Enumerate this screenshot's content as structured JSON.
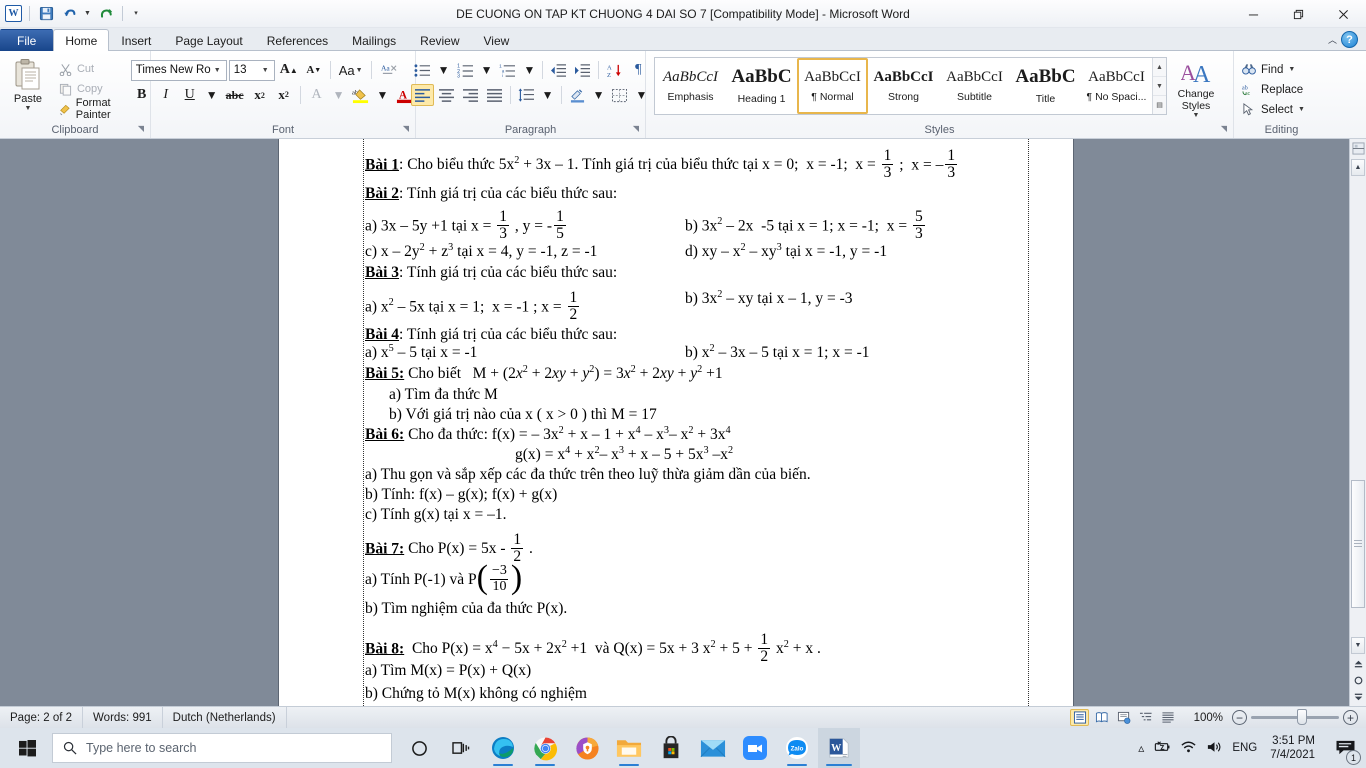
{
  "titlebar": {
    "document_title": "DE CUONG ON TAP KT CHUONG 4 DAI SO 7 [Compatibility Mode]  -  Microsoft Word",
    "qat": [
      "word-logo",
      "save",
      "undo",
      "redo",
      "customize-qat"
    ],
    "minimize": "—",
    "restore": "❐",
    "close": "✕"
  },
  "tabs": {
    "items": [
      {
        "label": "File",
        "kind": "file"
      },
      {
        "label": "Home",
        "kind": "active"
      },
      {
        "label": "Insert",
        "kind": "normal"
      },
      {
        "label": "Page Layout",
        "kind": "normal"
      },
      {
        "label": "References",
        "kind": "normal"
      },
      {
        "label": "Mailings",
        "kind": "normal"
      },
      {
        "label": "Review",
        "kind": "normal"
      },
      {
        "label": "View",
        "kind": "normal"
      }
    ],
    "help": "?"
  },
  "ribbon": {
    "clipboard": {
      "label": "Clipboard",
      "paste": "Paste",
      "cut": "Cut",
      "copy": "Copy",
      "format_painter": "Format Painter"
    },
    "font": {
      "label": "Font",
      "font_family": "Times New Rom",
      "font_size": "13",
      "grow": "A",
      "shrink": "A",
      "change_case": "Aa",
      "clear_formatting": "clear-formatting-icon",
      "bold": "B",
      "italic": "I",
      "underline": "U",
      "strikethrough": "abc",
      "subscript": "x",
      "superscript": "x",
      "text_effects": "A",
      "highlight": "ab",
      "font_color": "A"
    },
    "paragraph": {
      "label": "Paragraph",
      "bullets": "bullets-icon",
      "numbering": "numbering-icon",
      "multilevel": "multilevel-list-icon",
      "decrease_indent": "decrease-indent-icon",
      "increase_indent": "increase-indent-icon",
      "sort": "sort-icon",
      "show_marks": "¶",
      "align_left": "align-left-icon",
      "align_center": "align-center-icon",
      "align_right": "align-right-icon",
      "justify": "justify-icon",
      "line_spacing": "line-spacing-icon",
      "shading": "shading-icon",
      "borders": "borders-icon"
    },
    "styles": {
      "label": "Styles",
      "items": [
        {
          "preview": "AaBbCcI",
          "name": "Emphasis",
          "style": "emphasis"
        },
        {
          "preview": "AaBbC",
          "name": "Heading 1",
          "style": "heading1"
        },
        {
          "preview": "AaBbCcI",
          "name": "¶ Normal",
          "style": "normal",
          "selected": true
        },
        {
          "preview": "AaBbCcI",
          "name": "Strong",
          "style": "strong"
        },
        {
          "preview": "AaBbCcI",
          "name": "Subtitle",
          "style": "subtitle"
        },
        {
          "preview": "AaBbC",
          "name": "Title",
          "style": "title"
        },
        {
          "preview": "AaBbCcI",
          "name": "¶ No Spaci...",
          "style": "nospacing"
        }
      ],
      "change_styles": "Change Styles"
    },
    "editing": {
      "label": "Editing",
      "find": "Find",
      "replace": "Replace",
      "select": "Select"
    }
  },
  "document": {
    "lines": [
      {
        "id": "bai1",
        "label": "Bài 1",
        "text": ": Cho biểu thức 5x² + 3x – 1. Tính giá trị của biểu thức tại x = 0;  x = -1;  x = 1/3 ;  x = – 1/3"
      },
      {
        "id": "bai2",
        "label": "Bài 2",
        "text": ": Tính giá trị của các biểu thức sau:"
      },
      {
        "id": "bai2a",
        "text": "a) 3x – 5y +1 tại x = 1/3 , y = - 1/5"
      },
      {
        "id": "bai2b",
        "text": "b) 3x² – 2x  -5 tại x = 1; x = -1;  x = 5/3"
      },
      {
        "id": "bai2c",
        "text": "c) x – 2y² + z³ tại x = 4, y = -1, z = -1"
      },
      {
        "id": "bai2d",
        "text": "d) xy – x² – xy³ tại x = -1, y = -1"
      },
      {
        "id": "bai3",
        "label": "Bài 3",
        "text": ": Tính giá trị của các biểu thức sau:"
      },
      {
        "id": "bai3a",
        "text": "a) x² – 5x tại x = 1;  x = -1 ; x = 1/2"
      },
      {
        "id": "bai3b",
        "text": "b) 3x² – xy tại x – 1, y = -3"
      },
      {
        "id": "bai4",
        "label": "Bài 4",
        "text": ": Tính giá trị của các biểu thức sau:"
      },
      {
        "id": "bai4a",
        "text": "a) x⁵ – 5 tại x = -1"
      },
      {
        "id": "bai4b",
        "text": "b) x² – 3x – 5 tại x = 1; x = -1"
      },
      {
        "id": "bai5",
        "label": "Bài 5:",
        "text": " Cho biết   M + (2x² + 2xy + y²) = 3x² + 2xy + y² +1"
      },
      {
        "id": "bai5a",
        "text": "a)  Tìm đa thức M"
      },
      {
        "id": "bai5b",
        "text": "b)  Với giá trị nào của x ( x > 0 ) thì M = 17"
      },
      {
        "id": "bai6",
        "label": "Bài 6:",
        "text": " Cho đa thức: f(x) = – 3x² + x – 1 + x⁴ – x³– x² + 3x⁴"
      },
      {
        "id": "bai6g",
        "text": "g(x) = x⁴ + x²– x³ + x – 5 + 5x³ –x²"
      },
      {
        "id": "bai6a",
        "text": "a) Thu gọn và sắp xếp các đa thức trên theo luỹ thừa giảm dần của biến."
      },
      {
        "id": "bai6b",
        "text": "b) Tính: f(x) – g(x);  f(x) + g(x)"
      },
      {
        "id": "bai6c",
        "text": "c) Tính g(x) tại x = –1."
      },
      {
        "id": "bai7",
        "label": "Bài 7:",
        "text": " Cho P(x) = 5x - 1/2 ."
      },
      {
        "id": "bai7a",
        "text": "a) Tính P(-1) và P( –3/10 )"
      },
      {
        "id": "bai7b",
        "text": "b)  Tìm nghiệm của đa thức P(x)."
      },
      {
        "id": "bai8",
        "label": "Bài 8:",
        "text": "  Cho P(x) = x⁴ – 5x + 2x² +1  và Q(x) = 5x + 3 x² + 5 + 1/2 x² + x ."
      },
      {
        "id": "bai8a",
        "text": "a) Tìm  M(x) = P(x) + Q(x)"
      },
      {
        "id": "bai8b",
        "text": "b) Chứng tỏ  M(x) không có nghiệm"
      }
    ]
  },
  "statusbar": {
    "page": "Page: 2 of 2",
    "words": "Words: 991",
    "language": "Dutch (Netherlands)",
    "views": [
      "print-layout-icon",
      "full-screen-reading-icon",
      "web-layout-icon",
      "outline-icon",
      "draft-icon"
    ],
    "zoom": "100%",
    "zoom_out": "−",
    "zoom_in": "+"
  },
  "taskbar": {
    "start": "start-icon",
    "search_placeholder": "Type here to search",
    "cortana": "cortana-icon",
    "task_view": "task-view-icon",
    "apps": [
      {
        "name": "edge",
        "open": true
      },
      {
        "name": "chrome",
        "open": true
      },
      {
        "name": "avast-secure-browser",
        "open": false
      },
      {
        "name": "file-explorer",
        "open": true
      },
      {
        "name": "microsoft-store",
        "open": false
      },
      {
        "name": "mail",
        "open": false
      },
      {
        "name": "zoom",
        "open": false
      },
      {
        "name": "zalo",
        "open": true,
        "label": "Zalo"
      },
      {
        "name": "word",
        "open": true,
        "active": true
      }
    ],
    "tray": {
      "show_hidden": "∧",
      "battery": "battery-icon",
      "network": "wifi-icon",
      "volume": "volume-icon",
      "language": "ENG",
      "time": "3:51 PM",
      "date": "7/4/2021",
      "notifications": "notification-icon",
      "notification_count": "1"
    }
  }
}
